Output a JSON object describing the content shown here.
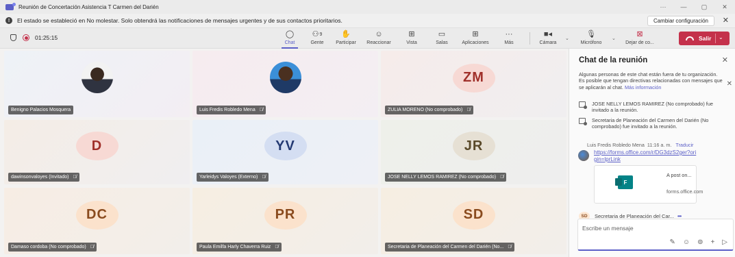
{
  "window": {
    "title": "Reunión de Concertación Asistencia T Carmen del Darién",
    "controls": [
      "···",
      "—",
      "▢",
      "✕"
    ]
  },
  "notice": {
    "message": "El estado se estableció en No molestar. Solo obtendrá las notificaciones de mensajes urgentes y de sus contactos prioritarios.",
    "change_label": "Cambiar configuración"
  },
  "toolbar": {
    "timer": "01:25:15",
    "chat": "Chat",
    "people": "Gente",
    "people_count": "9",
    "raise": "Participar",
    "react": "Reaccionar",
    "view": "Vista",
    "rooms": "Salas",
    "apps": "Aplicaciones",
    "more": "Más",
    "camera": "Cámara",
    "mic": "Micrófono",
    "share": "Dejar de co...",
    "leave": "Salir"
  },
  "participants": [
    {
      "name": "Benigno Palacios Mosquera",
      "initials": "",
      "photo": true,
      "muted": false
    },
    {
      "name": "Luis Fredis Robledo Mena",
      "initials": "",
      "photo": true,
      "muted": true
    },
    {
      "name": "ZULIA MORENO (No comprobado)",
      "initials": "ZM",
      "photo": false,
      "muted": true
    },
    {
      "name": "dawinsonvaloyes (Invitado)",
      "initials": "D",
      "photo": false,
      "muted": true
    },
    {
      "name": "Yarleidys Valoyes (Externo)",
      "initials": "YV",
      "photo": false,
      "muted": true
    },
    {
      "name": "JOSE NELLY LEMOS RAMIREZ (No comprobado)",
      "initials": "JR",
      "photo": false,
      "muted": true
    },
    {
      "name": "Damaso cordoba (No comprobado)",
      "initials": "DC",
      "photo": false,
      "muted": true
    },
    {
      "name": "Paula Emilfa Harly Chaverra Ruiz",
      "initials": "PR",
      "photo": false,
      "muted": true
    },
    {
      "name": "Secretaria de Planeación del Carmen del Darién (No...",
      "initials": "SD",
      "photo": false,
      "muted": true
    }
  ],
  "chat": {
    "title": "Chat de la reunión",
    "warning": "Algunas personas de este chat están fuera de tu organización. Es posible que tengan directivas relacionadas con mensajes que se aplicarán al chat.",
    "more_info": "Más información",
    "system_messages": [
      "JOSE NELLY LEMOS RAMIREZ (No comprobado) fue invitado a la reunión.",
      "Secretaria de Planeación del Carmen del Darién (No comprobado) fue invitado a la reunión."
    ],
    "message": {
      "sender": "Luis Fredis Robledo Mena",
      "time": "11:16 a. m.",
      "translate": "Traducir",
      "link": "https://forms.office.com/r/DG3dzS2ger?origin=lprLink",
      "card_title": "A post on...",
      "card_source": "forms.office.com"
    },
    "typing": {
      "initials": "SD",
      "name": "Secretaria de Planeación del Car..."
    },
    "compose_placeholder": "Escribe un mensaje"
  }
}
